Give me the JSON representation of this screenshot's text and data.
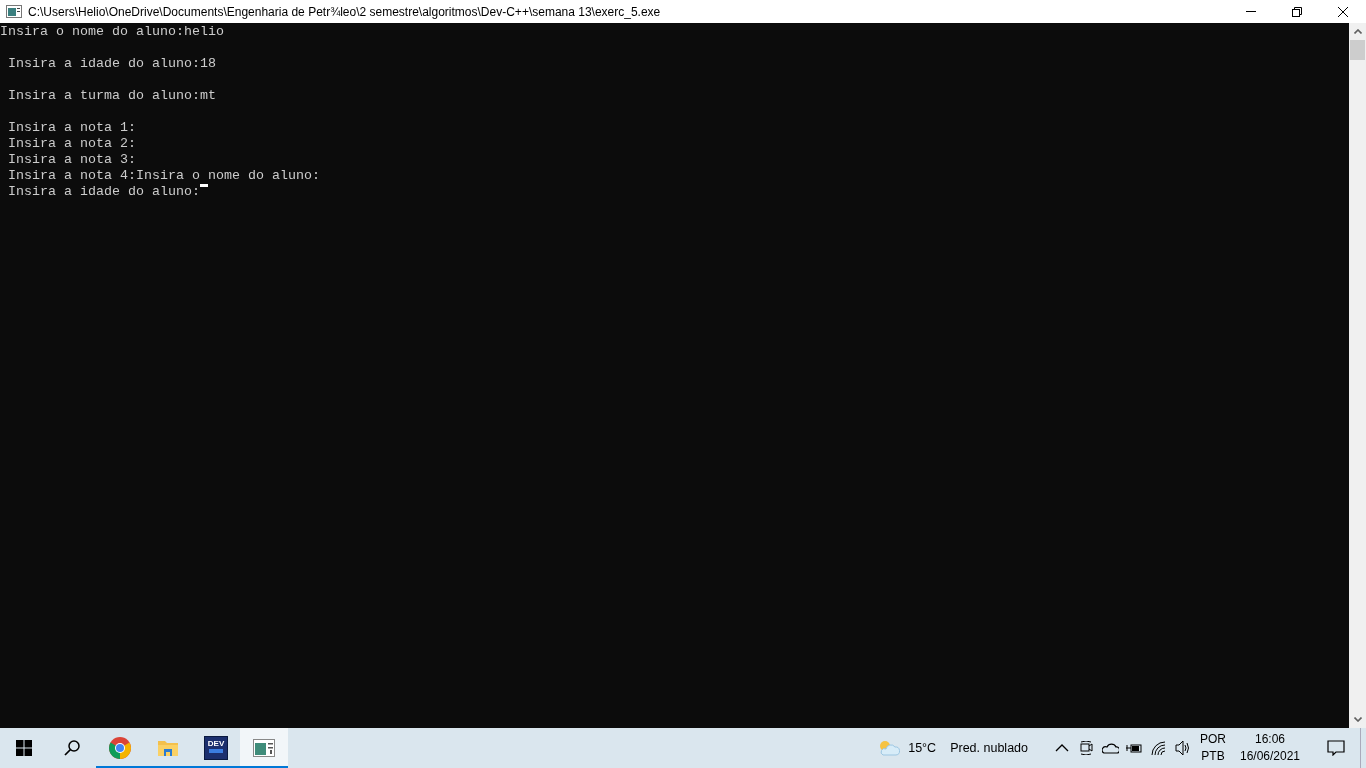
{
  "window": {
    "title": "C:\\Users\\Helio\\OneDrive\\Documents\\Engenharia de Petr¾leo\\2 semestre\\algoritmos\\Dev-C++\\semana 13\\exerc_5.exe"
  },
  "console": {
    "lines": [
      {
        "kind": "text",
        "text": "Insira o nome do aluno:helio"
      },
      {
        "kind": "blank"
      },
      {
        "kind": "text",
        "text": " Insira a idade do aluno:18"
      },
      {
        "kind": "blank"
      },
      {
        "kind": "text",
        "text": " Insira a turma do aluno:mt"
      },
      {
        "kind": "blank"
      },
      {
        "kind": "text",
        "text": " Insira a nota 1:"
      },
      {
        "kind": "text",
        "text": " Insira a nota 2:"
      },
      {
        "kind": "text",
        "text": " Insira a nota 3:"
      },
      {
        "kind": "text",
        "text": " Insira a nota 4:Insira o nome do aluno:"
      },
      {
        "kind": "text",
        "text": " Insira a idade do aluno:",
        "cursor": true
      }
    ]
  },
  "taskbar": {
    "apps": [
      {
        "kind": "chrome",
        "running": true,
        "active": false
      },
      {
        "kind": "folder",
        "running": true,
        "active": false
      },
      {
        "kind": "dev",
        "running": true,
        "active": false
      },
      {
        "kind": "console",
        "running": true,
        "active": true
      }
    ],
    "dev_icon_text": "DEV",
    "weather": {
      "temperature": "15°C",
      "condition": "Pred. nublado"
    },
    "language": {
      "top": "POR",
      "bottom": "PTB"
    },
    "clock": {
      "time": "16:06",
      "date": "16/06/2021"
    }
  }
}
